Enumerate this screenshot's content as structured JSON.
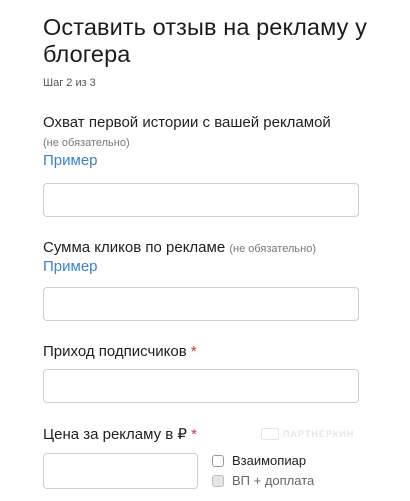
{
  "form": {
    "title": "Оставить отзыв на рекламу у блогера",
    "step": "Шаг 2 из 3",
    "reach": {
      "label": "Охват первой истории с вашей рекламой",
      "optional": "(не обязательно)",
      "example": "Пример",
      "value": ""
    },
    "clicks": {
      "label": "Сумма кликов по рекламе",
      "optional": "(не обязательно)",
      "example": "Пример",
      "value": ""
    },
    "subscribers": {
      "label": "Приход подписчиков",
      "required_mark": "*",
      "value": ""
    },
    "price": {
      "label": "Цена за рекламу в ₽",
      "required_mark": "*",
      "value": ""
    },
    "options": [
      {
        "label": "Взаимопиар",
        "checked": false,
        "disabled": false
      },
      {
        "label": "ВП + доплата",
        "checked": false,
        "disabled": true
      }
    ]
  },
  "watermark": {
    "text": "ПАРТНЕРКИН"
  },
  "colors": {
    "link": "#3b82c8",
    "required": "#d6333a",
    "border": "#cfcfcf"
  }
}
